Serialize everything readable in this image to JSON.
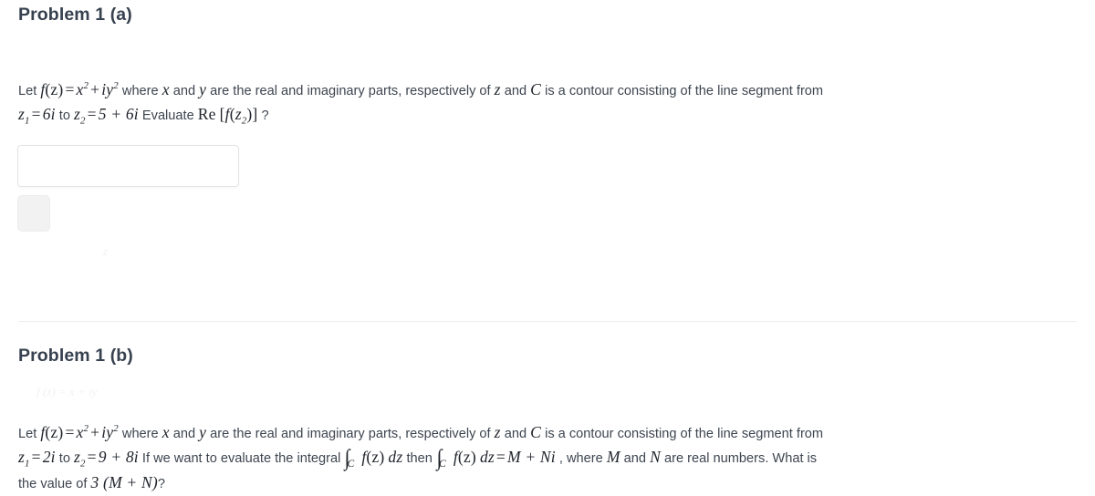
{
  "problems": [
    {
      "heading": "Problem 1 (a)",
      "intro": "Let ",
      "fn_f": "f",
      "fn_arg": "(z)",
      "eq": "=",
      "rhs_x": "x",
      "rhs_x_pow": "2",
      "plus": "+",
      "rhs_iy": "iy",
      "rhs_iy_pow": "2",
      "where": " where ",
      "var_x": "x",
      "and1": " and ",
      "var_y": "y",
      "mid1": " are the real and imaginary parts, respectively of ",
      "var_z": "z",
      "and2": " and ",
      "var_C": "C",
      "mid2": " is a contour consisting of the line segment from",
      "z1_sym": "z",
      "z1_sub": "1",
      "z1_eq": "=",
      "z1_val": "6i",
      "to": " to ",
      "z2_sym": "z",
      "z2_sub": "2",
      "z2_eq": "=",
      "z2_val": "5 + 6i",
      "tail": " Evaluate ",
      "re_op": "Re",
      "re_open": "[",
      "re_f": "f",
      "re_arg_open": "(",
      "re_z": "z",
      "re_z_sub": "2",
      "re_arg_close": ")",
      "re_close": "]",
      "question_mark": " ?",
      "answer_value": "",
      "answer_placeholder": ""
    },
    {
      "heading": "Problem 1 (b)",
      "intro": "Let ",
      "fn_f": "f",
      "fn_arg": "(z)",
      "eq": "=",
      "rhs_x": "x",
      "rhs_x_pow": "2",
      "plus": "+",
      "rhs_iy": "iy",
      "rhs_iy_pow": "2",
      "where": " where ",
      "var_x": "x",
      "and1": " and ",
      "var_y": "y",
      "mid1": " are the real and imaginary parts, respectively of ",
      "var_z": "z",
      "and2": " and ",
      "var_C": "C",
      "mid2": " is a contour consisting of the line segment from",
      "z1_sym": "z",
      "z1_sub": "1",
      "z1_eq": "=",
      "z1_val": "2i",
      "to": " to ",
      "z2_sym": "z",
      "z2_sub": "2",
      "z2_eq": "=",
      "z2_val": "9 + 8i",
      "tail": " If we want to evaluate the integral ",
      "int_sym": "∫",
      "int_sub": "C",
      "int_f": "f",
      "int_arg": "(z)",
      "int_dz": "dz",
      "then": " then ",
      "int2_sym": "∫",
      "int2_sub": "C",
      "int2_f": "f",
      "int2_arg": "(z)",
      "int2_dz": "dz",
      "int2_eq": "=",
      "int2_rhs": "M + Ni",
      "comma_where": " , where ",
      "var_M": "M",
      "and3": " and ",
      "var_N": "N",
      "tail2": " are real numbers. What is",
      "line3_intro": "the value of ",
      "line3_expr": "3 (M + N)",
      "line3_q": "?"
    }
  ],
  "colors": {
    "heading": "#37414f",
    "body_text": "#3d4550",
    "math_text": "#20242b",
    "input_border": "#e3e4e6",
    "button_bg": "#f2f2f2",
    "divider": "#ededee",
    "page_bg": "#ffffff"
  }
}
